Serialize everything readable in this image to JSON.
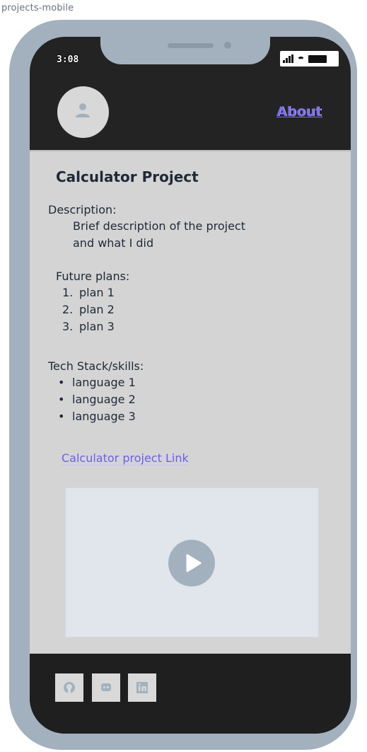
{
  "frame_label": "projects-mobile",
  "status_bar": {
    "time": "3:08"
  },
  "header": {
    "about_label": "About"
  },
  "project": {
    "title": "Calculator Project",
    "description_label": "Description:",
    "description_line1": "Brief description of the project",
    "description_line2": "and what I did",
    "future_label": "Future plans:",
    "plans": [
      {
        "num": "1.",
        "text": "plan 1"
      },
      {
        "num": "2.",
        "text": "plan 2"
      },
      {
        "num": "3.",
        "text": "plan 3"
      }
    ],
    "tech_label": "Tech Stack/skills:",
    "languages": [
      "language 1",
      "language 2",
      "language 3"
    ],
    "bullet": "•",
    "link_label": "Calculator project Link"
  },
  "footer": {
    "icons": [
      "github-icon",
      "discord-icon",
      "linkedin-icon"
    ]
  }
}
